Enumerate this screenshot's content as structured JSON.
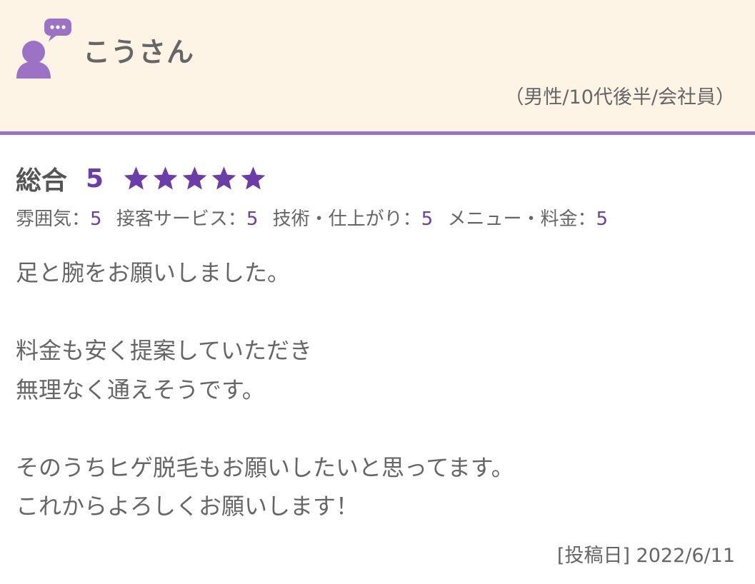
{
  "reviewer": {
    "name": "こうさん",
    "profile": "（男性/10代後半/会社員）"
  },
  "rating": {
    "overall_label": "総合",
    "overall_score": "5",
    "stars": 5,
    "star_color": "#6a3da8",
    "sub": [
      {
        "label": "雰囲気：",
        "value": "5"
      },
      {
        "label": "接客サービス：",
        "value": "5"
      },
      {
        "label": "技術・仕上がり：",
        "value": "5"
      },
      {
        "label": "メニュー・料金：",
        "value": "5"
      }
    ]
  },
  "comment": [
    "足と腕をお願いしました。",
    "",
    "料金も安く提案していただき",
    "無理なく通えそうです。",
    "",
    "そのうちヒゲ脱毛もお願いしたいと思ってます。",
    "これからよろしくお願いします！"
  ],
  "post_date": "[投稿日] 2022/6/11",
  "colors": {
    "header_bg": "#fdf4e6",
    "accent": "#9b72c4",
    "score": "#6a3da8",
    "text": "#666666"
  }
}
